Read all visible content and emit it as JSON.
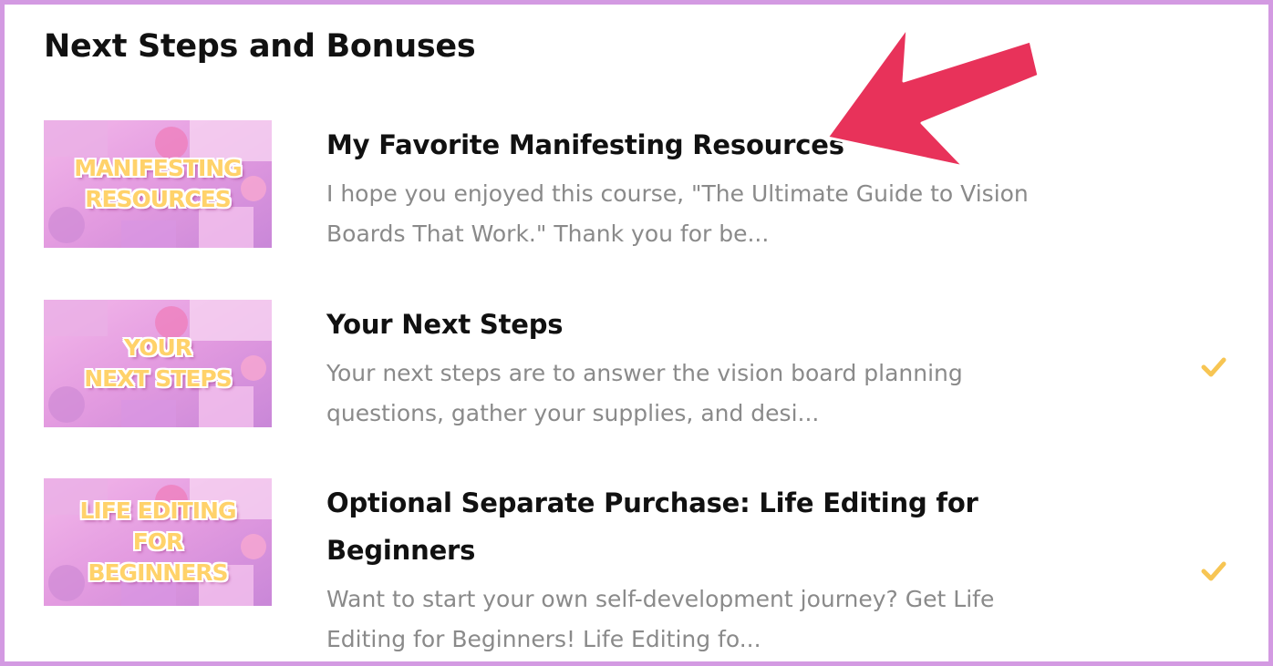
{
  "section": {
    "title": "Next Steps and Bonuses"
  },
  "lessons": [
    {
      "thumbnail_lines": [
        "MANIFESTING",
        "RESOURCES"
      ],
      "title": "My Favorite Manifesting Resources",
      "description": "I hope you enjoyed this course, \"The Ultimate Guide to Vision Boards That Work.\" Thank you for be...",
      "completed": false
    },
    {
      "thumbnail_lines": [
        "YOUR",
        "NEXT STEPS"
      ],
      "title": "Your Next Steps",
      "description": "Your next steps are to answer the vision board planning questions, gather your supplies, and desi...",
      "completed": true
    },
    {
      "thumbnail_lines": [
        "LIFE EDITING",
        "FOR",
        "BEGINNERS"
      ],
      "title": "Optional Separate Purchase: Life Editing for Beginners",
      "description": "Want to start your own self-development journey? Get Life Editing for Beginners! Life Editing fo...",
      "completed": true
    }
  ],
  "colors": {
    "border": "#d39ae2",
    "check": "#f7c553",
    "arrow": "#e8325a",
    "thumbnail_text": "#ffd26a"
  },
  "icons": {
    "completed": "checkmark-icon",
    "annotation": "arrow-icon"
  }
}
